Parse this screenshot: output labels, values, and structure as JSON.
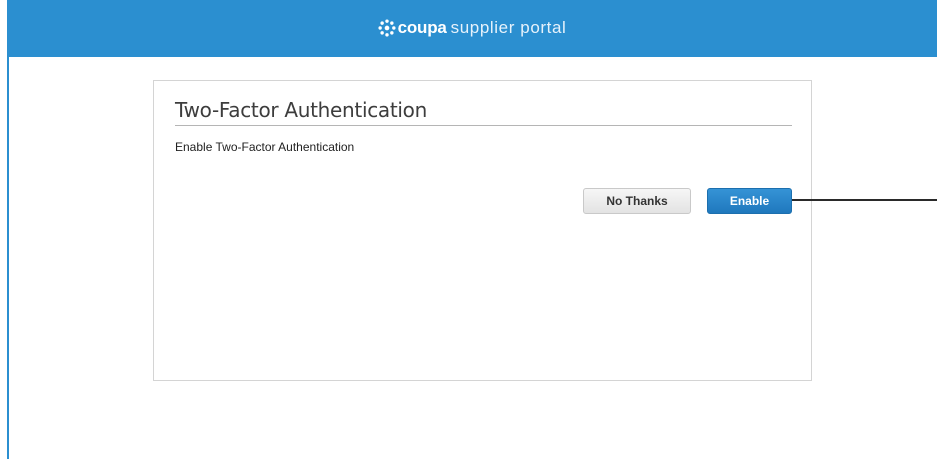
{
  "header": {
    "brand_name": "coupa",
    "brand_suffix": "supplier portal",
    "logo_icon": "coupa-sunburst-logo-icon",
    "background_color": "#2b8fd0"
  },
  "dialog": {
    "title": "Two-Factor Authentication",
    "description": "Enable Two-Factor Authentication",
    "secondary_button_label": "No Thanks",
    "primary_button_label": "Enable",
    "primary_button_color": "#2384c6"
  }
}
